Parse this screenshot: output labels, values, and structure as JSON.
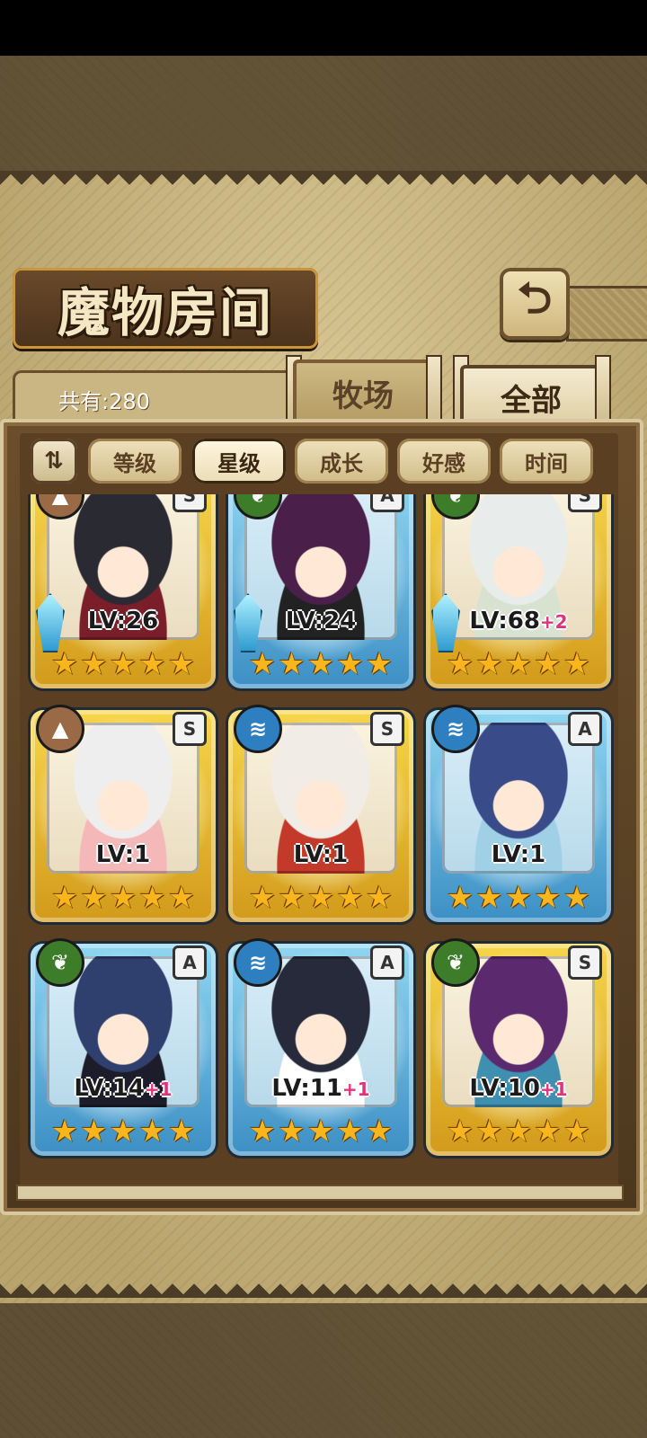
{
  "header": {
    "title": "魔物房间",
    "back_icon": "⮌",
    "count_label": "共有:280",
    "tabs": [
      {
        "label": "牧场",
        "active": false
      },
      {
        "label": "全部",
        "active": true
      }
    ]
  },
  "filters": {
    "sort_icon": "⇅",
    "items": [
      {
        "label": "等级",
        "active": false
      },
      {
        "label": "星级",
        "active": true
      },
      {
        "label": "成长",
        "active": false
      },
      {
        "label": "好感",
        "active": false
      },
      {
        "label": "时间",
        "active": false
      }
    ]
  },
  "monsters": [
    {
      "element": "earth",
      "element_icon": "▲",
      "rank": "S",
      "level": "LV:26",
      "bonus": "",
      "stars": 5,
      "frame": "gold",
      "weapon": true
    },
    {
      "element": "nature",
      "element_icon": "❦",
      "rank": "A",
      "level": "LV:24",
      "bonus": "",
      "stars": 5,
      "frame": "blue",
      "weapon": true
    },
    {
      "element": "nature",
      "element_icon": "❦",
      "rank": "S",
      "level": "LV:68",
      "bonus": "+2",
      "stars": 5,
      "frame": "gold",
      "weapon": true
    },
    {
      "element": "earth",
      "element_icon": "▲",
      "rank": "S",
      "level": "LV:1",
      "bonus": "",
      "stars": 5,
      "frame": "gold",
      "weapon": false
    },
    {
      "element": "water",
      "element_icon": "≋",
      "rank": "S",
      "level": "LV:1",
      "bonus": "",
      "stars": 5,
      "frame": "gold",
      "weapon": false
    },
    {
      "element": "water",
      "element_icon": "≋",
      "rank": "A",
      "level": "LV:1",
      "bonus": "",
      "stars": 5,
      "frame": "blue",
      "weapon": false
    },
    {
      "element": "nature",
      "element_icon": "❦",
      "rank": "A",
      "level": "LV:14",
      "bonus": "+1",
      "stars": 5,
      "frame": "blue",
      "weapon": false
    },
    {
      "element": "water",
      "element_icon": "≋",
      "rank": "A",
      "level": "LV:11",
      "bonus": "+1",
      "stars": 5,
      "frame": "blue",
      "weapon": false
    },
    {
      "element": "nature",
      "element_icon": "❦",
      "rank": "S",
      "level": "LV:10",
      "bonus": "+1",
      "stars": 5,
      "frame": "gold",
      "weapon": false
    }
  ],
  "colors": {
    "gold_frame": "#f7d64a",
    "blue_frame": "#8fd6f2",
    "bonus": "#e2337a",
    "star": "#f8b51c"
  }
}
